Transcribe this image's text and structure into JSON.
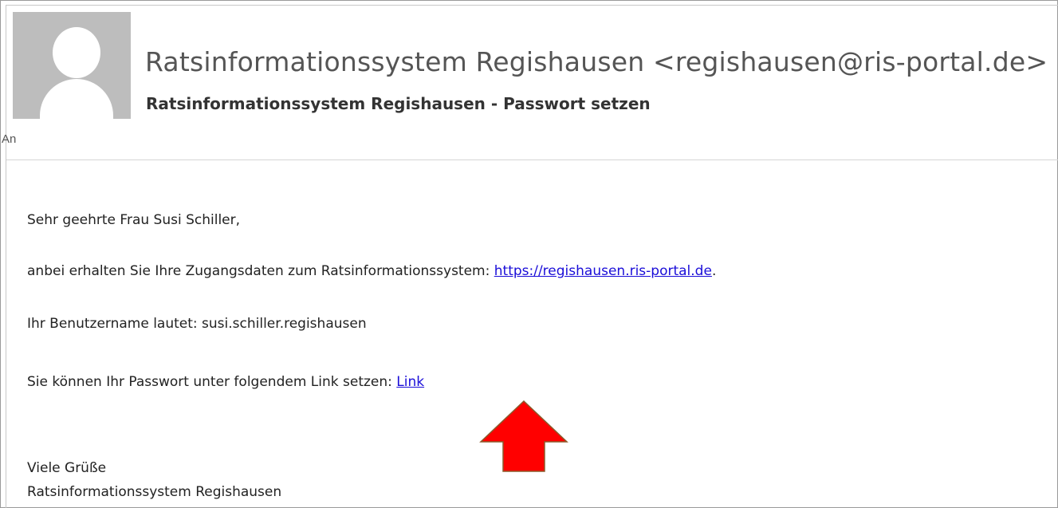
{
  "email": {
    "sender": "Ratsinformationssystem Regishausen <regishausen@ris-portal.de>",
    "subject": "Ratsinformationssystem Regishausen - Passwort setzen",
    "to_label": "An"
  },
  "body": {
    "greeting": "Sehr geehrte Frau Susi Schiller,",
    "access_text": "anbei erhalten Sie Ihre Zugangsdaten zum Ratsinformationssystem: ",
    "portal_link": "https://regishausen.ris-portal.de",
    "access_suffix": ".",
    "username_text": "Ihr Benutzername lautet: susi.schiller.regishausen",
    "password_text": "Sie können Ihr Passwort unter folgendem Link setzen: ",
    "password_link": "Link",
    "closing": "Viele Grüße",
    "signature": "Ratsinformationssystem Regishausen"
  },
  "icons": {
    "avatar": "default-person-avatar",
    "annotation": "red-up-arrow"
  },
  "colors": {
    "link": "#1a0dd8",
    "arrow_fill": "#ff0000",
    "arrow_stroke": "#8b5a2b",
    "avatar_bg": "#bdbdbd"
  }
}
